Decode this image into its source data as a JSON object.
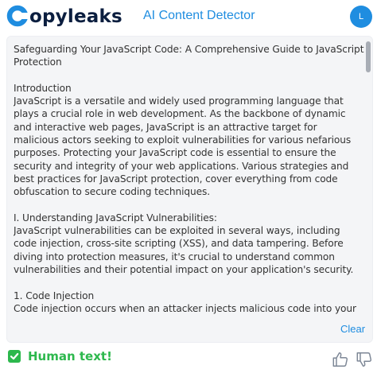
{
  "header": {
    "logo_text": "opyleaks",
    "logo_brand": "Copyleaks",
    "title": "AI Content Detector",
    "avatar_initial": "L",
    "brand_color": "#0b1e3f",
    "accent_color": "#1f8de0"
  },
  "document": {
    "text": "Safeguarding Your JavaScript Code: A Comprehensive Guide to JavaScript Protection\n\nIntroduction\nJavaScript is a versatile and widely used programming language that plays a crucial role in web development. As the backbone of dynamic and interactive web pages, JavaScript is an attractive target for malicious actors seeking to exploit vulnerabilities for various nefarious purposes. Protecting your JavaScript code is essential to ensure the security and integrity of your web applications. Various strategies and best practices for JavaScript protection, cover everything from code obfuscation to secure coding techniques.\n\nI. Understanding JavaScript Vulnerabilities:\nJavaScript vulnerabilities can be exploited in several ways, including code injection, cross-site scripting (XSS), and data tampering. Before diving into protection measures, it's crucial to understand common vulnerabilities and their potential impact on your application's security.\n\n1. Code Injection\nCode injection occurs when an attacker injects malicious code into your JavaScript, leading to unintended behavior or security breaches. This can"
  },
  "actions": {
    "clear_label": "Clear"
  },
  "result": {
    "label": "Human text!",
    "status_color": "#2db84d",
    "icon": "check-icon"
  },
  "feedback": {
    "up_icon": "thumbs-up-icon",
    "down_icon": "thumbs-down-icon"
  }
}
